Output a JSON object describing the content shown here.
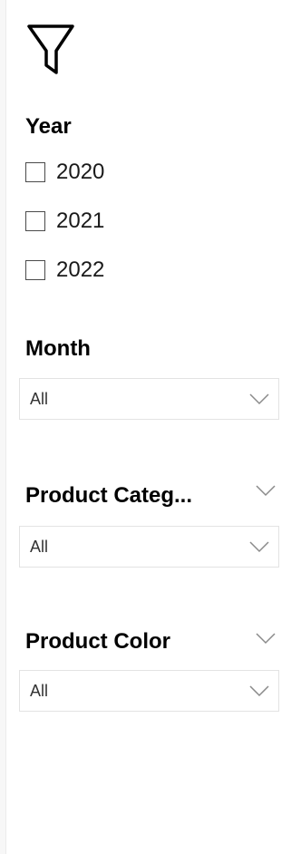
{
  "filter_icon": "funnel-icon",
  "slicers": {
    "year": {
      "title": "Year",
      "options": [
        "2020",
        "2021",
        "2022"
      ]
    },
    "month": {
      "title": "Month",
      "value": "All"
    },
    "product_category": {
      "title": "Product Categ...",
      "value": "All"
    },
    "product_color": {
      "title": "Product Color",
      "value": "All"
    }
  },
  "colors": {
    "text": "#000000",
    "border": "#e3e3e3",
    "chevron": "#8a8a8a",
    "checkbox_border": "#4a4a4a"
  }
}
